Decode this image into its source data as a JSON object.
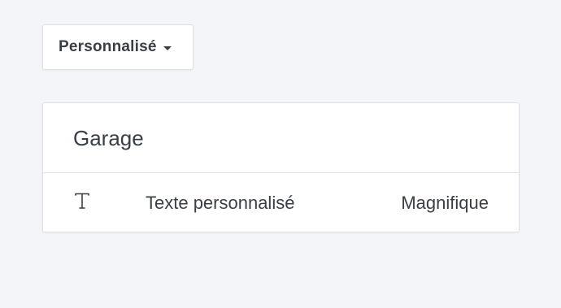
{
  "dropdown": {
    "label": "Personnalisé",
    "caret_icon": "caret-down-icon"
  },
  "card": {
    "title": "Garage",
    "rows": [
      {
        "icon": "text-type-icon",
        "label": "Texte personnalisé",
        "value": "Magnifique"
      }
    ]
  },
  "colors": {
    "background": "#f4f5f9",
    "surface": "#ffffff",
    "border": "#dde0e6",
    "text": "#3a3f46"
  }
}
